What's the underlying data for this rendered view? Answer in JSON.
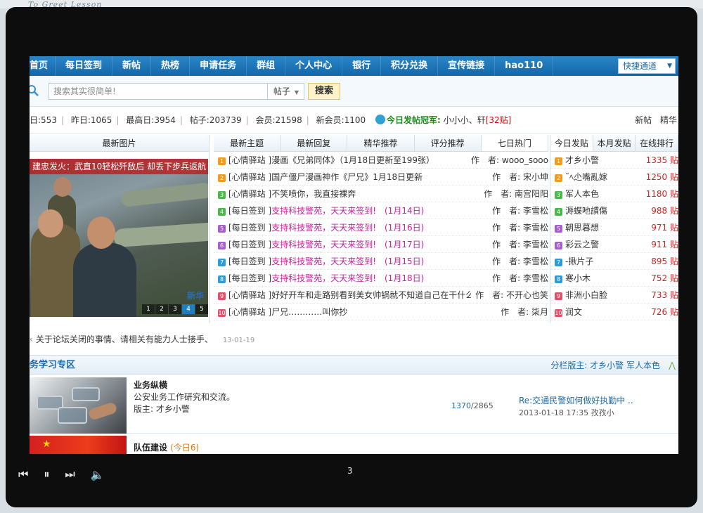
{
  "top_caption": "To Greet Lesson",
  "nav": {
    "items": [
      "首页",
      "每日签到",
      "新帖",
      "热榜",
      "申请任务",
      "群组",
      "个人中心",
      "银行",
      "积分兑换",
      "宣传链接",
      "hao110"
    ],
    "quick_label": "快捷通道"
  },
  "search": {
    "placeholder": "搜索其实很简单!",
    "type": "帖子",
    "button": "搜索"
  },
  "stats": {
    "today": "日:553",
    "yesterday": "昨日:1065",
    "max": "最高日:3954",
    "posts": "帖子:203739",
    "members": "会员:21598",
    "new_members": "新会员:1100",
    "champ_label": "今日发帖冠军:",
    "champ_name": "小小小、轩",
    "champ_count": "[32贴]",
    "links": [
      "新帖",
      "精华"
    ]
  },
  "pics": {
    "header": "最新图片",
    "caption": "建忠发火：武直10轻松歼敌后 却丢下步兵返航",
    "pages": [
      "1",
      "2",
      "3",
      "4",
      "5"
    ],
    "mark": "新华"
  },
  "topics": {
    "tabs": [
      "最新主题",
      "最新回复",
      "精华推荐",
      "评分推荐",
      "七日热门"
    ],
    "rows": [
      {
        "num": "1",
        "color": "#f39a1d",
        "cat": "[心情驿站 ]",
        "title": "漫画《兄弟同体》（1月18日更新至199张）",
        "pink": false,
        "author": "作　者: wooo_sooo"
      },
      {
        "num": "2",
        "color": "#f39a1d",
        "cat": "[心情驿站 ]",
        "title": "国产僵尸漫画神作《尸兄》1月18日更新",
        "pink": false,
        "author": "作　者: 宋小坤"
      },
      {
        "num": "3",
        "color": "#4bb84b",
        "cat": "[心情驿站 ]",
        "title": "不笑喷你，我直接裸奔",
        "pink": false,
        "author": "作　者: 南宫阳阳"
      },
      {
        "num": "4",
        "color": "#4bb84b",
        "cat": "[每日签到 ]",
        "title": "支持科技警苑，天天来签到!　(1月14日)",
        "pink": true,
        "author": "作　者: 李雪松"
      },
      {
        "num": "5",
        "color": "#a55ed0",
        "cat": "[每日签到 ]",
        "title": "支持科技警苑，天天来签到!　(1月16日)",
        "pink": true,
        "author": "作　者: 李雪松"
      },
      {
        "num": "6",
        "color": "#a55ed0",
        "cat": "[每日签到 ]",
        "title": "支持科技警苑，天天来签到!　(1月17日)",
        "pink": true,
        "author": "作　者: 李雪松"
      },
      {
        "num": "7",
        "color": "#2d9bd8",
        "cat": "[每日签到 ]",
        "title": "支持科技警苑，天天来签到!　(1月15日)",
        "pink": true,
        "author": "作　者: 李雪松"
      },
      {
        "num": "8",
        "color": "#2d9bd8",
        "cat": "[每日签到 ]",
        "title": "支持科技警苑，天天来签到!　(1月18日)",
        "pink": true,
        "author": "作　者: 李雪松"
      },
      {
        "num": "9",
        "color": "#e0506a",
        "cat": "[心情驿站 ]",
        "title": "好好开车和走路别看到美女帅锅就不知道自己在干什么",
        "pink": false,
        "author": "作　者: 不开心也笑"
      },
      {
        "num": "10",
        "color": "#e0506a",
        "cat": "[心情驿站 ]",
        "title": "尸兄…………叫你抄",
        "pink": false,
        "author": "作　者: 柒月"
      }
    ]
  },
  "ranks": {
    "tabs": [
      "今日发贴",
      "本月发贴",
      "在线排行"
    ],
    "rows": [
      {
        "num": "1",
        "color": "#f39a1d",
        "name": "才乡小警",
        "count": "1335 贴"
      },
      {
        "num": "2",
        "color": "#f39a1d",
        "name": "˜ﾍ尐嘴亂嫁",
        "count": "1250 贴"
      },
      {
        "num": "3",
        "color": "#4bb84b",
        "name": "军人本色",
        "count": "1180 贴"
      },
      {
        "num": "4",
        "color": "#4bb84b",
        "name": "溽蝶吔謴傷",
        "count": "988 贴"
      },
      {
        "num": "5",
        "color": "#a55ed0",
        "name": "朝思暮想",
        "count": "971 贴"
      },
      {
        "num": "6",
        "color": "#a55ed0",
        "name": "彩云之警",
        "count": "911 贴"
      },
      {
        "num": "7",
        "color": "#2d9bd8",
        "name": "-揪片子",
        "count": "895 贴"
      },
      {
        "num": "8",
        "color": "#2d9bd8",
        "name": "寒小木",
        "count": "752 贴"
      },
      {
        "num": "9",
        "color": "#e0506a",
        "name": "非洲小白脸",
        "count": "733 贴"
      },
      {
        "num": "10",
        "color": "#e0506a",
        "name": "润文",
        "count": "726 贴"
      }
    ]
  },
  "notice": {
    "text": "关于论坛关闭的事情、请相关有能力人士接手、",
    "date": "13-01-19"
  },
  "section": {
    "title": "务学习专区",
    "mods_label": "分栏版主: 才乡小警 军人本色",
    "collapse": "⋀"
  },
  "forums": [
    {
      "name": "业务纵横",
      "desc": "公安业务工作研究和交流。",
      "mod": "版主: 才乡小警",
      "threads": "1370",
      "posts": "/2865",
      "last_title": "Re:交通民警如何做好执勤中 ..",
      "last_meta": "2013-01-18 17:35 孜孜小"
    },
    {
      "name": "队伍建设",
      "today": "(今日6)"
    }
  ],
  "player": {
    "slide": "3"
  }
}
